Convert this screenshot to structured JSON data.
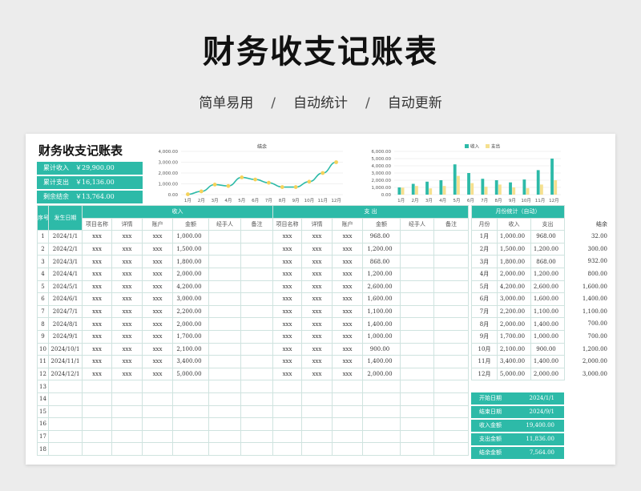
{
  "hero": {
    "title": "财务收支记账表",
    "subtitle_parts": [
      "简单易用",
      "/",
      "自动统计",
      "/",
      "自动更新"
    ]
  },
  "sheet": {
    "title": "财务收支记账表",
    "summary": [
      {
        "label": "累计收入",
        "value": "￥29,900.00"
      },
      {
        "label": "累计支出",
        "value": "￥16,136.00"
      },
      {
        "label": "剩余结余",
        "value": "￥13,764.00"
      }
    ]
  },
  "colors": {
    "accent": "#2dbaa8",
    "income_bar": "#2dbaa8",
    "expense_bar": "#f5e08f",
    "point": "#f5d25b"
  },
  "chart_data": [
    {
      "type": "line",
      "title": "结余",
      "categories": [
        "1月",
        "2月",
        "3月",
        "4月",
        "5月",
        "6月",
        "7月",
        "8月",
        "9月",
        "10月",
        "11月",
        "12月"
      ],
      "values": [
        32,
        300,
        932,
        800,
        1600,
        1400,
        1100,
        700,
        700,
        1200,
        2000,
        3000
      ],
      "yticks": [
        "0.00",
        "1,000.00",
        "2,000.00",
        "3,000.00",
        "4,000.00"
      ],
      "ylim": [
        0,
        4000
      ]
    },
    {
      "type": "bar",
      "categories": [
        "1月",
        "2月",
        "3月",
        "4月",
        "5月",
        "6月",
        "7月",
        "8月",
        "9月",
        "10月",
        "11月",
        "12月"
      ],
      "series": [
        {
          "name": "收入",
          "values": [
            1000,
            1500,
            1800,
            2000,
            4200,
            3000,
            2200,
            2000,
            1700,
            2100,
            3400,
            5000
          ]
        },
        {
          "name": "支出",
          "values": [
            968,
            1200,
            868,
            1200,
            2600,
            1600,
            1100,
            1400,
            1000,
            900,
            1400,
            2000
          ]
        }
      ],
      "yticks": [
        "0.00",
        "1,000.00",
        "2,000.00",
        "3,000.00",
        "4,000.00",
        "5,000.00",
        "6,000.00"
      ],
      "ylim": [
        0,
        6000
      ],
      "legend": "top"
    }
  ],
  "table": {
    "h_index": "序号",
    "h_date": "发生日期",
    "h_income": "收入",
    "h_expense": "支    出",
    "h_monthly": "月份统计（自动）",
    "h_balance": "结余",
    "sub_income": [
      "项目名称",
      "详情",
      "账户",
      "金额",
      "经手人",
      "备注"
    ],
    "sub_expense": [
      "项目名称",
      "详情",
      "账户",
      "金额",
      "经手人",
      "备注"
    ],
    "sub_monthly": [
      "月份",
      "收入",
      "支出"
    ],
    "rows": [
      {
        "no": "1",
        "date": "2024/1/1",
        "a": "xxx",
        "b": "xxx",
        "c": "xxx",
        "inc": "1,000.00",
        "d": "xxx",
        "e": "xxx",
        "f": "xxx",
        "exp": "968.00",
        "m": "1月",
        "mi": "1,000.00",
        "me": "968.00",
        "bal": "32.00"
      },
      {
        "no": "2",
        "date": "2024/2/1",
        "a": "xxx",
        "b": "xxx",
        "c": "xxx",
        "inc": "1,500.00",
        "d": "xxx",
        "e": "xxx",
        "f": "xxx",
        "exp": "1,200.00",
        "m": "2月",
        "mi": "1,500.00",
        "me": "1,200.00",
        "bal": "300.00"
      },
      {
        "no": "3",
        "date": "2024/3/1",
        "a": "xxx",
        "b": "xxx",
        "c": "xxx",
        "inc": "1,800.00",
        "d": "xxx",
        "e": "xxx",
        "f": "xxx",
        "exp": "868.00",
        "m": "3月",
        "mi": "1,800.00",
        "me": "868.00",
        "bal": "932.00"
      },
      {
        "no": "4",
        "date": "2024/4/1",
        "a": "xxx",
        "b": "xxx",
        "c": "xxx",
        "inc": "2,000.00",
        "d": "xxx",
        "e": "xxx",
        "f": "xxx",
        "exp": "1,200.00",
        "m": "4月",
        "mi": "2,000.00",
        "me": "1,200.00",
        "bal": "800.00"
      },
      {
        "no": "5",
        "date": "2024/5/1",
        "a": "xxx",
        "b": "xxx",
        "c": "xxx",
        "inc": "4,200.00",
        "d": "xxx",
        "e": "xxx",
        "f": "xxx",
        "exp": "2,600.00",
        "m": "5月",
        "mi": "4,200.00",
        "me": "2,600.00",
        "bal": "1,600.00"
      },
      {
        "no": "6",
        "date": "2024/6/1",
        "a": "xxx",
        "b": "xxx",
        "c": "xxx",
        "inc": "3,000.00",
        "d": "xxx",
        "e": "xxx",
        "f": "xxx",
        "exp": "1,600.00",
        "m": "6月",
        "mi": "3,000.00",
        "me": "1,600.00",
        "bal": "1,400.00"
      },
      {
        "no": "7",
        "date": "2024/7/1",
        "a": "xxx",
        "b": "xxx",
        "c": "xxx",
        "inc": "2,200.00",
        "d": "xxx",
        "e": "xxx",
        "f": "xxx",
        "exp": "1,100.00",
        "m": "7月",
        "mi": "2,200.00",
        "me": "1,100.00",
        "bal": "1,100.00"
      },
      {
        "no": "8",
        "date": "2024/8/1",
        "a": "xxx",
        "b": "xxx",
        "c": "xxx",
        "inc": "2,000.00",
        "d": "xxx",
        "e": "xxx",
        "f": "xxx",
        "exp": "1,400.00",
        "m": "8月",
        "mi": "2,000.00",
        "me": "1,400.00",
        "bal": "700.00"
      },
      {
        "no": "9",
        "date": "2024/9/1",
        "a": "xxx",
        "b": "xxx",
        "c": "xxx",
        "inc": "1,700.00",
        "d": "xxx",
        "e": "xxx",
        "f": "xxx",
        "exp": "1,000.00",
        "m": "9月",
        "mi": "1,700.00",
        "me": "1,000.00",
        "bal": "700.00"
      },
      {
        "no": "10",
        "date": "2024/10/1",
        "a": "xxx",
        "b": "xxx",
        "c": "xxx",
        "inc": "2,100.00",
        "d": "xxx",
        "e": "xxx",
        "f": "xxx",
        "exp": "900.00",
        "m": "10月",
        "mi": "2,100.00",
        "me": "900.00",
        "bal": "1,200.00"
      },
      {
        "no": "11",
        "date": "2024/11/1",
        "a": "xxx",
        "b": "xxx",
        "c": "xxx",
        "inc": "3,400.00",
        "d": "xxx",
        "e": "xxx",
        "f": "xxx",
        "exp": "1,400.00",
        "m": "11月",
        "mi": "3,400.00",
        "me": "1,400.00",
        "bal": "2,000.00"
      },
      {
        "no": "12",
        "date": "2024/12/1",
        "a": "xxx",
        "b": "xxx",
        "c": "xxx",
        "inc": "5,000.00",
        "d": "xxx",
        "e": "xxx",
        "f": "xxx",
        "exp": "2,000.00",
        "m": "12月",
        "mi": "5,000.00",
        "me": "2,000.00",
        "bal": "3,000.00"
      }
    ],
    "empty_rows": [
      "13",
      "14",
      "15",
      "16",
      "17",
      "18"
    ]
  },
  "stats": [
    {
      "label": "开始日期",
      "value": "2024/1/1"
    },
    {
      "label": "结束日期",
      "value": "2024/9/1"
    },
    {
      "label": "收入金额",
      "value": "19,400.00"
    },
    {
      "label": "支出金额",
      "value": "11,836.00"
    },
    {
      "label": "结余金额",
      "value": "7,564.00"
    }
  ]
}
